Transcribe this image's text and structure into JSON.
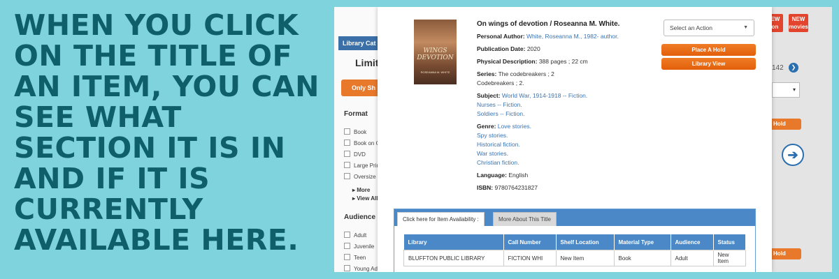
{
  "headline": "WHEN YOU CLICK ON THE TITLE OF AN ITEM, YOU CAN SEE WHAT SECTION IT IS IN AND IF IT IS CURRENTLY AVAILABLE HERE.",
  "background": {
    "catalog_tab": "Library Cat",
    "limit_heading": "Limit S",
    "only_button": "Only Sh",
    "format_heading": "Format",
    "format_items": [
      "Book",
      "Book on C",
      "DVD",
      "Large Prin",
      "Oversize"
    ],
    "more_link": "▸ More",
    "view_all_link": "▸ View All",
    "audience_heading": "Audience",
    "audience_items": [
      "Adult",
      "Juvenile",
      "Teen",
      "Young Adu"
    ],
    "badge_new_1_top": "NEW",
    "badge_new_1_bottom": "tion",
    "badge_new_2_top": "NEW",
    "badge_new_2_bottom": "movies",
    "pager_text": "142",
    "select_caret": "▾",
    "hold_label_1": "Hold",
    "hold_label_2": "Hold"
  },
  "record": {
    "title": "On wings of devotion / Roseanna M. White.",
    "cover_title_1": "WINGS",
    "cover_title_2": "DEVOTION",
    "cover_author": "ROSEANNA M. WHITE",
    "personal_author_label": "Personal Author:",
    "personal_author": "White, Roseanna M., 1982- author.",
    "pub_date_label": "Publication Date:",
    "pub_date": "2020",
    "physical_label": "Physical Description:",
    "physical": "388 pages ; 22 cm",
    "series_label": "Series:",
    "series": [
      "The codebreakers ; 2",
      "Codebreakers ; 2."
    ],
    "subject_label": "Subject:",
    "subjects": [
      "World War, 1914-1918 -- Fiction.",
      "Nurses -- Fiction.",
      "Soldiers -- Fiction."
    ],
    "genre_label": "Genre:",
    "genres": [
      "Love stories.",
      "Spy stories.",
      "Historical fiction.",
      "War stories.",
      "Christian fiction."
    ],
    "language_label": "Language:",
    "language": "English",
    "isbn_label": "ISBN:",
    "isbn": "9780764231827"
  },
  "actions": {
    "select_placeholder": "Select an Action",
    "place_hold": "Place A Hold",
    "library_view": "Library View"
  },
  "availability": {
    "tab_active": "Click here for Item Availability :",
    "tab_more": "More About This Title",
    "headers": [
      "Library",
      "Call Number",
      "Shelf Location",
      "Material Type",
      "Audience",
      "Status"
    ],
    "rows": [
      [
        "BLUFFTON PUBLIC LIBRARY",
        "FICTION WHI",
        "New Item",
        "Book",
        "Adult",
        "New Item"
      ]
    ]
  },
  "colors": {
    "page_bg": "#7fd3dc",
    "headline": "#0e5f6a",
    "accent_orange": "#e8792b",
    "table_blue": "#4a88c8",
    "link_blue": "#3a74b5"
  }
}
